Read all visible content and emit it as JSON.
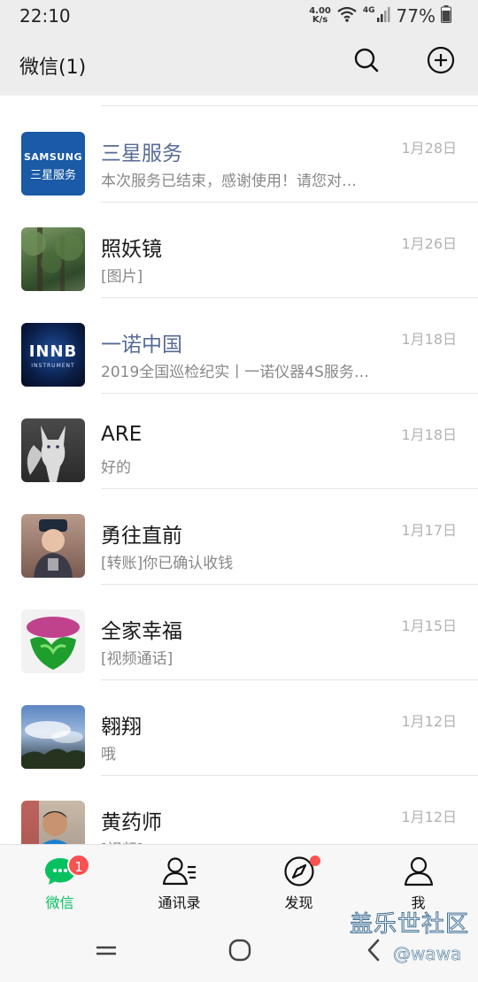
{
  "status": {
    "time": "22:10",
    "net_speed_value": "4.00",
    "net_speed_unit": "K/s",
    "network_type": "4G",
    "battery": "77%"
  },
  "header": {
    "title": "微信(1)",
    "search_icon": "search-icon",
    "add_icon": "plus-circle-icon"
  },
  "chats": [
    {
      "name": "三星服务",
      "message": "本次服务已结束，感谢使用！请您对…",
      "date": "1月28日",
      "official": true,
      "avatar_text_top": "SAMSUNG",
      "avatar_text_bottom": "三星服务"
    },
    {
      "name": "照妖镜",
      "message": "[图片]",
      "date": "1月26日",
      "official": false
    },
    {
      "name": "一诺中国",
      "message": "2019全国巡检纪实丨一诺仪器4S服务…",
      "date": "1月18日",
      "official": true,
      "avatar_text_top": "INNB",
      "avatar_text_bottom": "INSTRUMENT"
    },
    {
      "name": "ARE",
      "message": "好的",
      "date": "1月18日",
      "official": false
    },
    {
      "name": "勇往直前",
      "message": "[转账]你已确认收钱",
      "date": "1月17日",
      "official": false
    },
    {
      "name": "全家幸福",
      "message": "[视频通话]",
      "date": "1月15日",
      "official": false
    },
    {
      "name": "翱翔",
      "message": "哦",
      "date": "1月12日",
      "official": false
    },
    {
      "name": "黄药师",
      "message": "[视频]",
      "date": "1月12日",
      "official": false
    }
  ],
  "tabs": [
    {
      "label": "微信",
      "badge": "1",
      "icon": "chat-bubble-icon"
    },
    {
      "label": "通讯录",
      "icon": "contacts-icon"
    },
    {
      "label": "发现",
      "icon": "compass-icon"
    },
    {
      "label": "我",
      "icon": "person-icon"
    }
  ],
  "watermark": {
    "line1": "盖乐世社区",
    "line2": "@wawa"
  },
  "colors": {
    "accent": "#07c160",
    "badge": "#fa5151",
    "official_name": "#576b95"
  }
}
